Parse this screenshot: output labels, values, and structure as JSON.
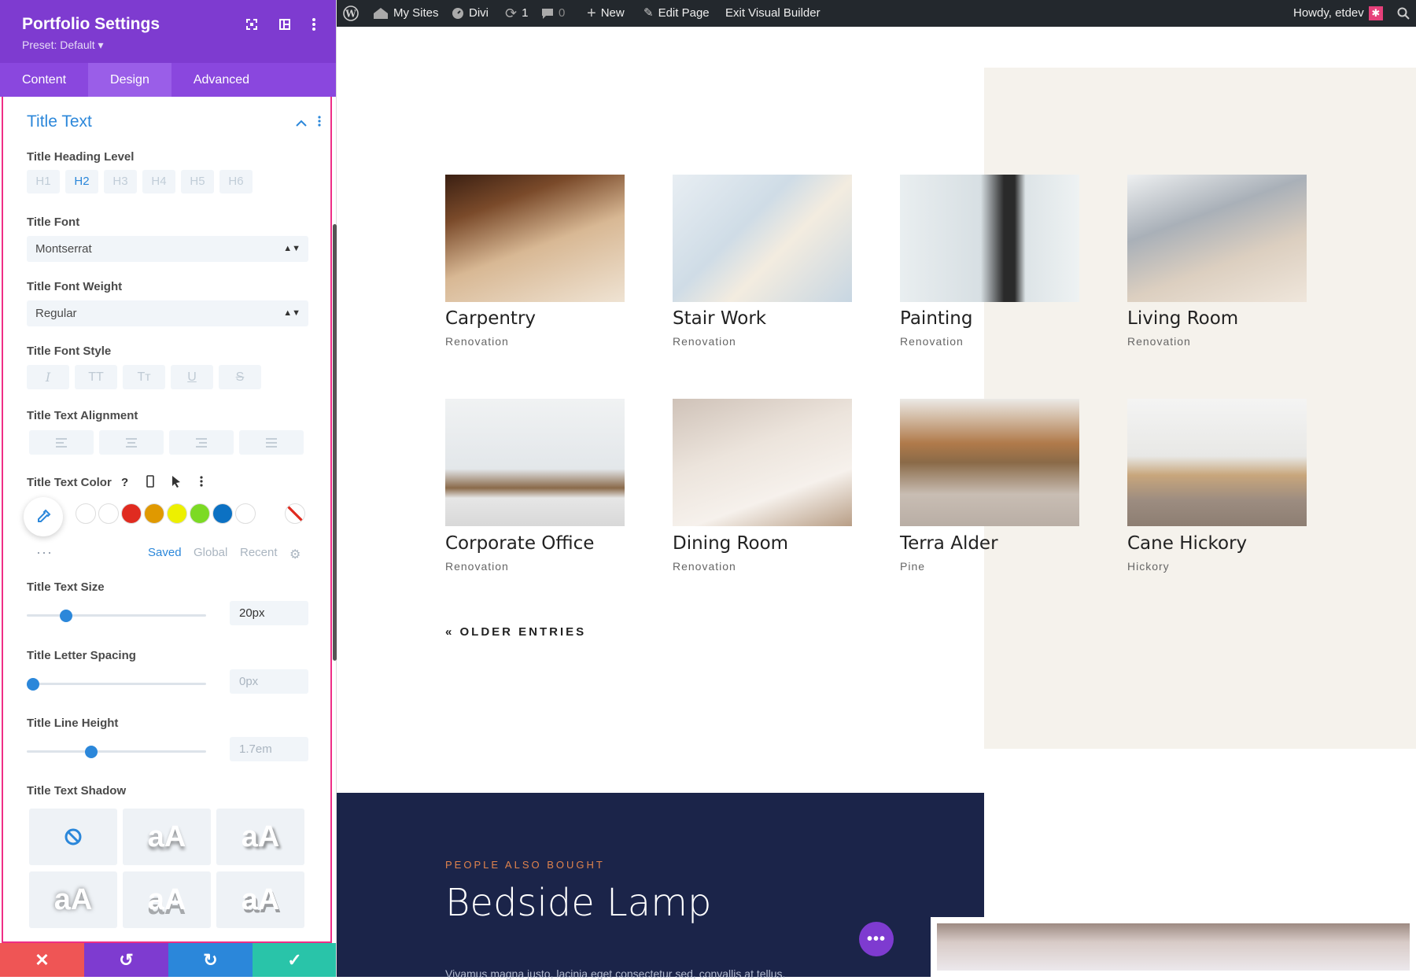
{
  "panel": {
    "title": "Portfolio Settings",
    "preset": "Preset: Default ▾",
    "tabs": [
      "Content",
      "Design",
      "Advanced"
    ],
    "section": "Title Text",
    "heading_level_label": "Title Heading Level",
    "heading_levels": [
      "H1",
      "H2",
      "H3",
      "H4",
      "H5",
      "H6"
    ],
    "font_label": "Title Font",
    "font_value": "Montserrat",
    "weight_label": "Title Font Weight",
    "weight_value": "Regular",
    "style_label": "Title Font Style",
    "align_label": "Title Text Alignment",
    "color_label": "Title Text Color",
    "color_tabs": [
      "Saved",
      "Global",
      "Recent"
    ],
    "swatches": [
      "#ffffff",
      "#ffffff",
      "#e02b20",
      "#e09900",
      "#edf000",
      "#7cda24",
      "#0c71c3",
      "#ffffff"
    ],
    "size_label": "Title Text Size",
    "size_value": "20px",
    "size_level": 0.2,
    "spacing_label": "Title Letter Spacing",
    "spacing_value": "0px",
    "spacing_level": 0,
    "lineheight_label": "Title Line Height",
    "lineheight_value": "1.7em",
    "lineheight_level": 0.35,
    "shadow_label": "Title Text Shadow",
    "shadow_sample": "aA"
  },
  "adminbar": {
    "mysites": "My Sites",
    "divi": "Divi",
    "updates": "1",
    "comments": "0",
    "new": "New",
    "edit": "Edit Page",
    "exit": "Exit Visual Builder",
    "howdy": "Howdy, etdev"
  },
  "portfolio": [
    {
      "title": "Carpentry",
      "category": "Renovation"
    },
    {
      "title": "Stair Work",
      "category": "Renovation"
    },
    {
      "title": "Painting",
      "category": "Renovation"
    },
    {
      "title": "Living Room",
      "category": "Renovation"
    },
    {
      "title": "Corporate Office",
      "category": "Renovation"
    },
    {
      "title": "Dining Room",
      "category": "Renovation"
    },
    {
      "title": "Terra Alder",
      "category": "Pine"
    },
    {
      "title": "Cane Hickory",
      "category": "Hickory"
    }
  ],
  "older_entries": "« OLDER ENTRIES",
  "promo": {
    "eyebrow": "PEOPLE ALSO BOUGHT",
    "title": "Bedside Lamp",
    "text": "Vivamus magna justo, lacinia eget consectetur sed, convallis at tellus."
  }
}
